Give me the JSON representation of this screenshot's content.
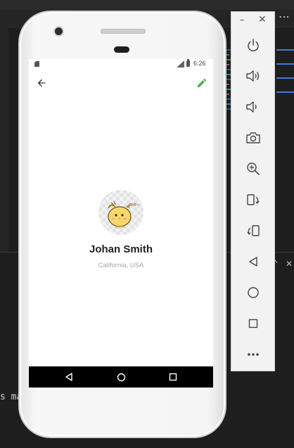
{
  "editor": {
    "more_label": "⋯",
    "code_snippet": "s ma"
  },
  "status_bar": {
    "time": "6:26"
  },
  "app_bar": {
    "back_icon": "arrow-back-icon",
    "edit_icon": "pencil-icon",
    "accent_color": "#4caf50"
  },
  "profile": {
    "name": "Johan Smith",
    "location": "California, USA",
    "avatar_icon": "chick-bye-sticker"
  },
  "nav_bar": {
    "items": [
      "back-triangle-icon",
      "home-circle-icon",
      "recents-square-icon"
    ]
  },
  "emulator_toolbar": {
    "minimize": "–",
    "close": "✕",
    "tools": [
      "power-icon",
      "volume-up-icon",
      "volume-down-icon",
      "camera-icon",
      "zoom-icon",
      "rotate-left-icon",
      "rotate-right-icon",
      "back-icon",
      "home-icon",
      "overview-icon",
      "more-icon"
    ]
  }
}
